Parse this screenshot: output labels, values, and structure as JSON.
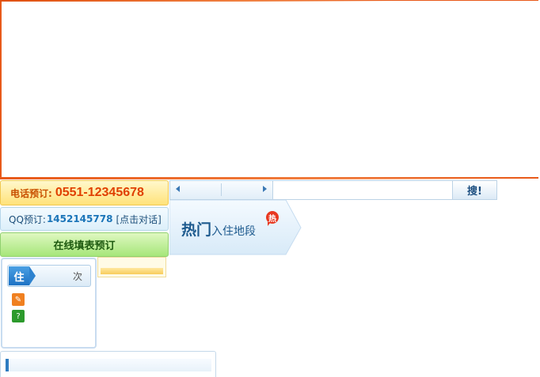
{
  "contact": {
    "phone_label": "电话预订:",
    "phone_number": "0551-12345678",
    "qq_label": "QQ预订:",
    "qq_number": "1452145778",
    "qq_link": "[点击对话]",
    "online_label": "在线填表预订"
  },
  "search": {
    "value": "",
    "button_label": "搜!"
  },
  "hot_area": {
    "strong": "热门",
    "light": "入住地段",
    "tag": "热"
  },
  "stay_panel": {
    "tag": "住",
    "count_suffix": "次",
    "icons": [
      "orange-doc-icon",
      "green-info-icon"
    ]
  },
  "colors": {
    "accent_orange": "#e85a1a",
    "phone_orange": "#e04000",
    "link_blue": "#1a74b8",
    "brand_blue": "#1d5a8e",
    "green": "#1e5a10"
  }
}
